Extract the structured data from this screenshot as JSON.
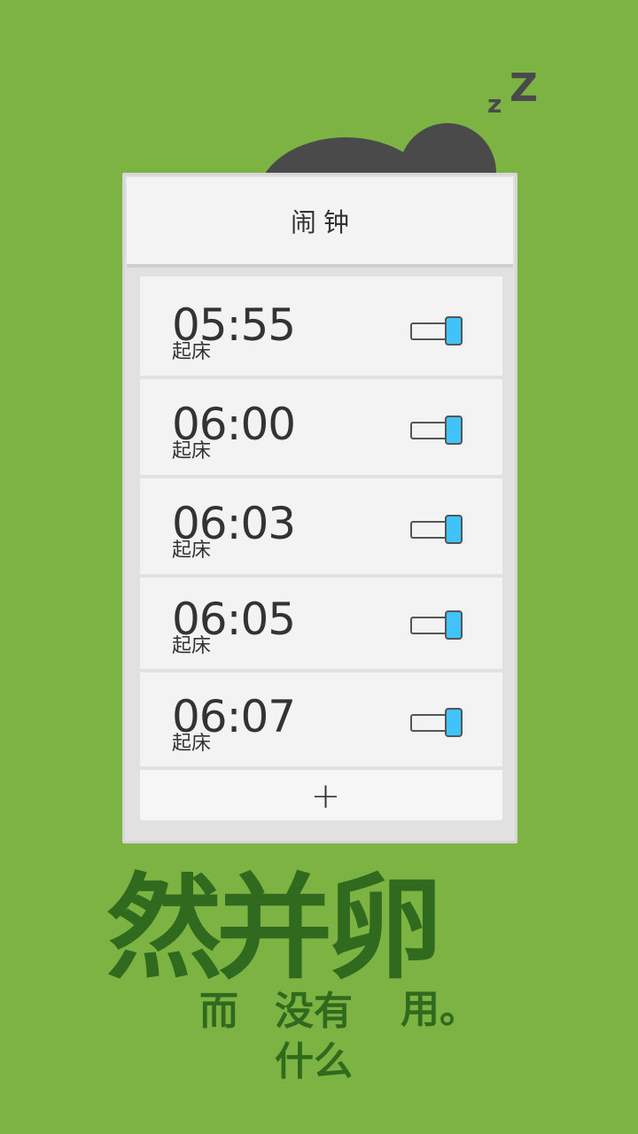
{
  "header": {
    "title": "闹钟"
  },
  "alarms": [
    {
      "time": "05:55",
      "label": "起床",
      "enabled": true
    },
    {
      "time": "06:00",
      "label": "起床",
      "enabled": true
    },
    {
      "time": "06:03",
      "label": "起床",
      "enabled": true
    },
    {
      "time": "06:05",
      "label": "起床",
      "enabled": true
    },
    {
      "time": "06:07",
      "label": "起床",
      "enabled": true
    }
  ],
  "add_button": {
    "label": "+"
  },
  "decoration": {
    "zzz_small": "z",
    "zzz_big": "Z"
  },
  "slogan": {
    "main": "然并卵",
    "sub_1": "而",
    "sub_2": "没有",
    "sub_3": "用。",
    "sub_4": "什么"
  },
  "colors": {
    "background": "#7db343",
    "toggle_on": "#40c2fb",
    "slogan": "#2f6a1f"
  }
}
